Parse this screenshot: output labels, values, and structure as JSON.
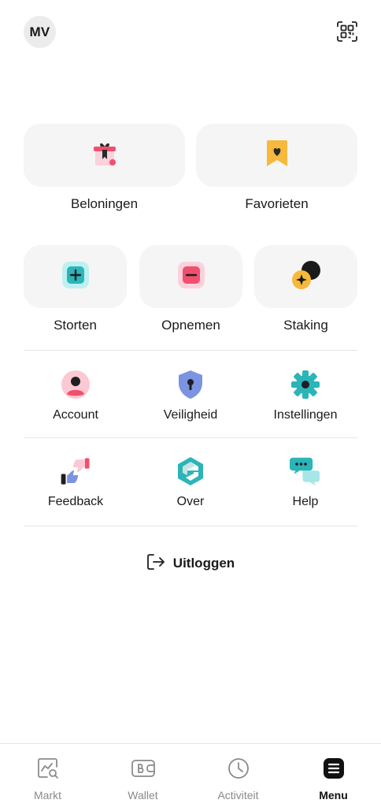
{
  "header": {
    "avatar_initials": "MV",
    "qr_icon": "qr-scan-icon"
  },
  "top_tiles": [
    {
      "label": "Beloningen",
      "icon": "gift-icon"
    },
    {
      "label": "Favorieten",
      "icon": "bookmark-heart-icon"
    }
  ],
  "action_tiles": [
    {
      "label": "Storten",
      "icon": "deposit-plus-icon"
    },
    {
      "label": "Opnemen",
      "icon": "withdraw-minus-icon"
    },
    {
      "label": "Staking",
      "icon": "staking-icon"
    }
  ],
  "settings_row": [
    {
      "label": "Account",
      "icon": "user-icon"
    },
    {
      "label": "Veiligheid",
      "icon": "shield-lock-icon"
    },
    {
      "label": "Instellingen",
      "icon": "gear-icon"
    }
  ],
  "info_row": [
    {
      "label": "Feedback",
      "icon": "thumbs-feedback-icon"
    },
    {
      "label": "Over",
      "icon": "brand-logo-icon"
    },
    {
      "label": "Help",
      "icon": "chat-bubbles-icon"
    }
  ],
  "logout": {
    "label": "Uitloggen",
    "icon": "logout-icon"
  },
  "bottom_nav": [
    {
      "label": "Markt",
      "icon": "chart-search-icon",
      "active": false
    },
    {
      "label": "Wallet",
      "icon": "wallet-icon",
      "active": false
    },
    {
      "label": "Activiteit",
      "icon": "clock-icon",
      "active": false
    },
    {
      "label": "Menu",
      "icon": "menu-icon",
      "active": true
    }
  ],
  "colors": {
    "pink": "#f0506e",
    "teal": "#2bb5b8",
    "yellow": "#f6b93b",
    "blue_shield": "#7b93e0"
  }
}
